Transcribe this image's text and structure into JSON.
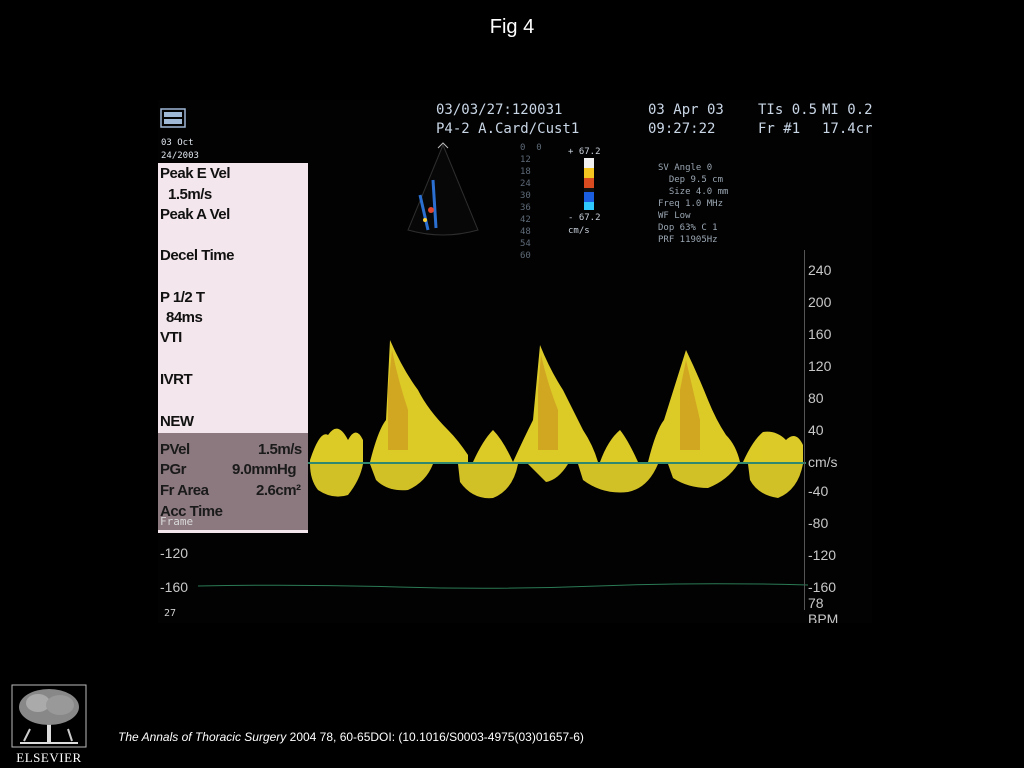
{
  "figure_title": "Fig 4",
  "echo_header": {
    "logo_text": "",
    "patient_id": "03/03/27:120031",
    "probe": "P4-2 A.Card/Cust1",
    "date": "03 Apr 03",
    "time": "09:27:22",
    "tis": "TIs 0.5",
    "frame": "Fr #1",
    "mi": "MI 0.2",
    "depth": "17.4cr",
    "left_small_1": "03 Oct",
    "left_small_2": "24/2003",
    "sv_settings": "SV Angle 0\n  Dep 9.5 cm\n  Size 4.0 mm\nFreq 1.0 MHz\nWF Low\nDop 63% C 1\nPRF 11905Hz",
    "color_scale_top": "+ 67.2",
    "color_scale_bottom": "- 67.2",
    "color_scale_unit": "cm/s"
  },
  "measurements_panel": {
    "peak_e_vel_label": "Peak E Vel",
    "peak_e_vel_value": "1.5m/s",
    "peak_a_vel_label": "Peak A Vel",
    "decel_time_label": "Decel Time",
    "p_half_t_label": "P 1/2 T",
    "p_half_t_value": "84ms",
    "vti_label": "VTI",
    "ivrt_label": "IVRT",
    "new_label": "NEW",
    "pvel_label": "PVel",
    "pvel_value": "1.5m/s",
    "pgr_label": "PGr",
    "pgr_value": "9.0mmHg",
    "area_label": "Fr Area",
    "area_value": "2.6cm²",
    "acc_time_label": "Acc Time",
    "frame_label": "Frame"
  },
  "right_axis": {
    "ticks": [
      "240",
      "200",
      "160",
      "120",
      "80",
      "40",
      "cm/s",
      "-40",
      "-80",
      "-120",
      "-160"
    ],
    "bpm_value": "78",
    "bpm_label": "BPM"
  },
  "left_axis": {
    "ticks": [
      "-120",
      "-160"
    ],
    "bottom_label": "27"
  },
  "citation": {
    "journal": "The Annals of Thoracic Surgery",
    "details": " 2004 78, 60-65DOI: (10.1016/S0003-4975(03)01657-6)"
  },
  "publisher_logo": "ELSEVIER",
  "colors": {
    "doppler_yellow": "#f2e12a",
    "doppler_orange": "#d38a1a",
    "baseline": "#4bd9b0",
    "panel": "#f3e6ec"
  }
}
